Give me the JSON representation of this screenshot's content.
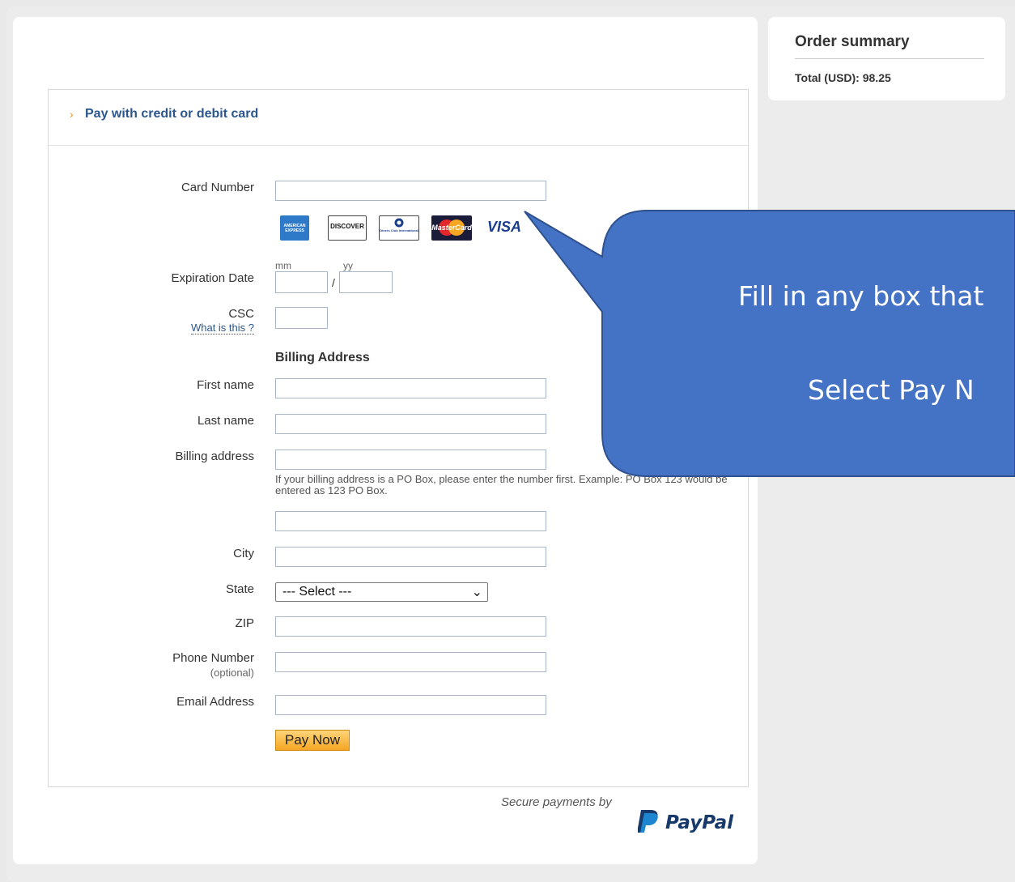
{
  "form": {
    "title": "Pay with credit or debit card",
    "card_number_label": "Card Number",
    "card_brands": {
      "amex": "AMERICAN EXPRESS",
      "discover": "DISCOVER",
      "diners": "Diners Club International",
      "mastercard": "MasterCard",
      "visa": "VISA"
    },
    "expiration_label": "Expiration Date",
    "mm_hint": "mm",
    "yy_hint": "yy",
    "slash": "/",
    "csc_label": "CSC",
    "csc_help": "What is this ?",
    "billing_section": "Billing Address",
    "first_name_label": "First name",
    "last_name_label": "Last name",
    "billing_address_label": "Billing address",
    "po_box_note": "If your billing address is a PO Box, please enter the number first. Example: PO Box 123 would be entered as 123 PO Box.",
    "city_label": "City",
    "state_label": "State",
    "state_selected": "--- Select ---",
    "zip_label": "ZIP",
    "phone_label": "Phone Number",
    "phone_optional": "(optional)",
    "email_label": "Email Address",
    "pay_button": "Pay Now"
  },
  "footer": {
    "secure_text": "Secure payments by",
    "brand": "PayPal"
  },
  "summary": {
    "title": "Order summary",
    "total": "Total (USD): 98.25"
  },
  "callout": {
    "line1": "Fill in any box that",
    "line2": "Select Pay N"
  },
  "colors": {
    "callout_fill": "#4472c4",
    "link_blue": "#2b578e",
    "button_orange": "#f5a623"
  }
}
